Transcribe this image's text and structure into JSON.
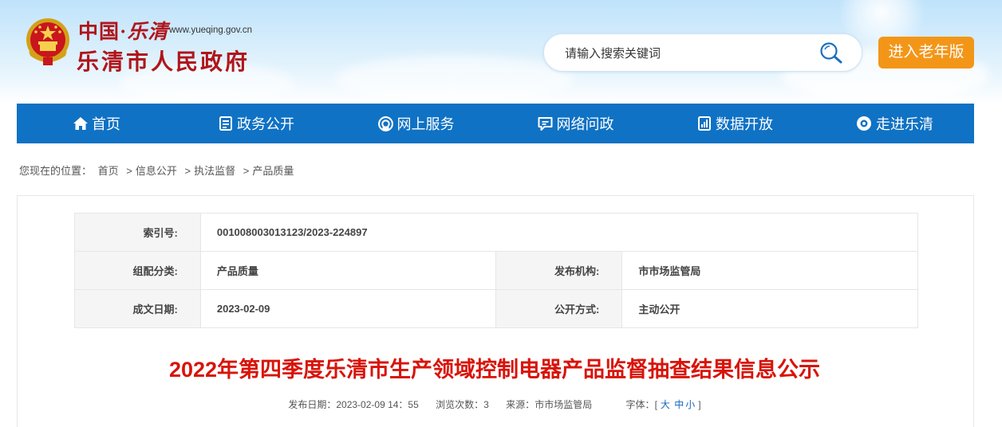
{
  "header": {
    "logo_cn_prefix": "中国·",
    "logo_cn_city": "乐清",
    "logo_url": "www.yueqing.gov.cn",
    "logo_title": "乐清市人民政府",
    "search_placeholder": "请输入搜索关键词",
    "elder_label": "进入老年版"
  },
  "nav": {
    "items": [
      {
        "label": "首页",
        "icon": "home-icon"
      },
      {
        "label": "政务公开",
        "icon": "document-icon"
      },
      {
        "label": "网上服务",
        "icon": "service-icon"
      },
      {
        "label": "网络问政",
        "icon": "chat-icon"
      },
      {
        "label": "数据开放",
        "icon": "data-icon"
      },
      {
        "label": "走进乐清",
        "icon": "eye-icon"
      }
    ]
  },
  "breadcrumb": {
    "prefix": "您现在的位置：",
    "items": [
      "首页",
      "信息公开",
      "执法监督",
      "产品质量"
    ],
    "separator": ">"
  },
  "meta": {
    "index_key": "索引号:",
    "index_value": "001008003013123/2023-224897",
    "category_key": "组配分类:",
    "category_value": "产品质量",
    "publisher_key": "发布机构:",
    "publisher_value": "市市场监管局",
    "date_key": "成文日期:",
    "date_value": "2023-02-09",
    "mode_key": "公开方式:",
    "mode_value": "主动公开"
  },
  "article": {
    "title": "2022年第四季度乐清市生产领域控制电器产品监督抽查结果信息公示",
    "publish_label": "发布日期：",
    "publish_value": "2023-02-09 14：55",
    "views_label": "浏览次数：",
    "views_value": "3",
    "source_label": "来源：",
    "source_value": "市市场监管局",
    "font_label": "字体：",
    "font_open": "[",
    "font_large": "大",
    "font_medium": "中",
    "font_small": "小",
    "font_close": "]"
  },
  "colors": {
    "nav_bg": "#0f72c4",
    "brand_red": "#b0151b",
    "title_red": "#d8140a",
    "elder_orange": "#f39618"
  }
}
